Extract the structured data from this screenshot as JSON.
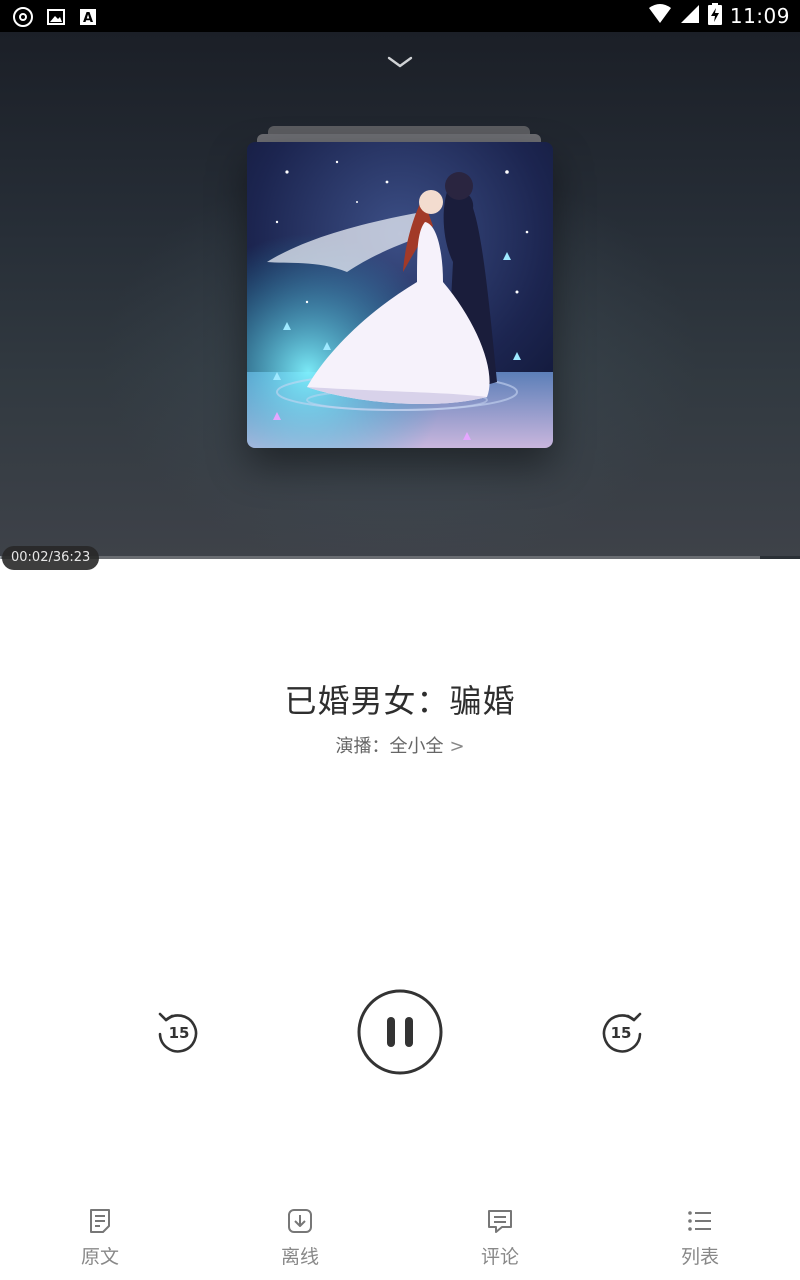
{
  "status_bar": {
    "time": "11:09",
    "icons": [
      "disc-icon",
      "image-icon",
      "font-icon",
      "wifi-icon",
      "signal-icon",
      "battery-charging-icon"
    ]
  },
  "player": {
    "collapse_icon": "chevron-down-icon",
    "cover_icon": "album-cover-art",
    "elapsed_time": "00:02/36:23",
    "progress": 0.001
  },
  "track": {
    "title": "已婚男女：骗婚",
    "narrator": "演播：全小全",
    "narrator_arrow": ">"
  },
  "controls": {
    "rewind": {
      "icon": "rewind-15-icon",
      "label": "15"
    },
    "play_pause": {
      "icon": "pause-icon",
      "state": "playing"
    },
    "forward": {
      "icon": "forward-15-icon",
      "label": "15"
    }
  },
  "bottom_nav": {
    "items": [
      {
        "label": "原文",
        "icon": "document-icon"
      },
      {
        "label": "离线",
        "icon": "download-icon"
      },
      {
        "label": "评论",
        "icon": "comment-icon"
      },
      {
        "label": "列表",
        "icon": "list-icon"
      }
    ]
  },
  "colors": {
    "hero_top": "#1b1f27",
    "hero_bottom": "#3e4249",
    "text_primary": "#2e2e2e",
    "text_secondary": "#666666",
    "nav_text": "#888888",
    "control": "#333333"
  }
}
